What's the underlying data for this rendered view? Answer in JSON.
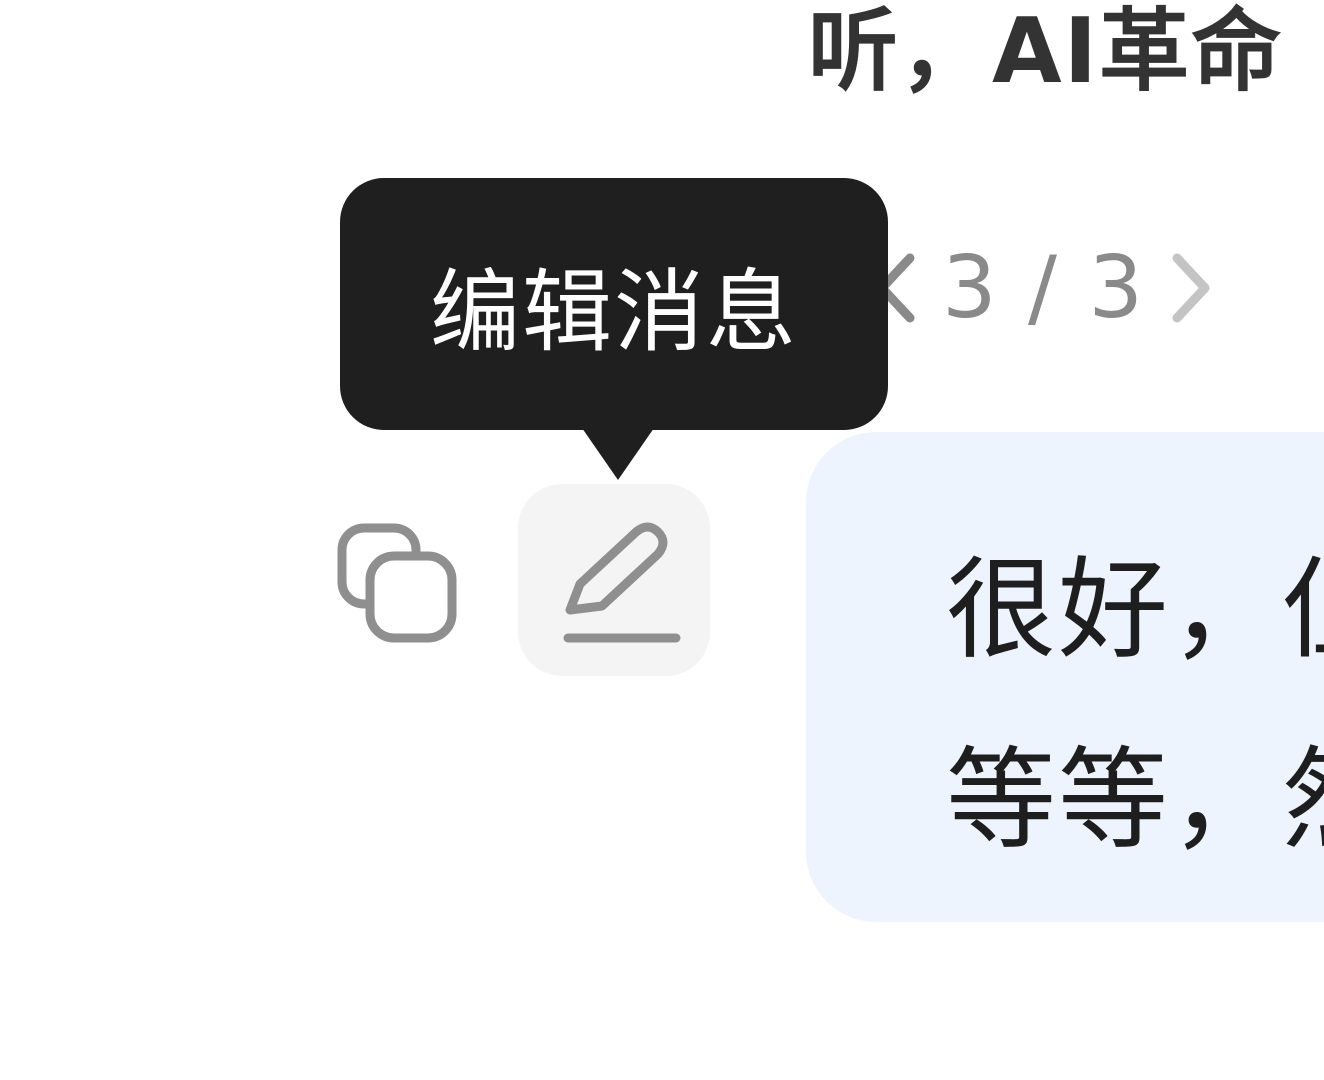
{
  "heading": {
    "text": "听，AI革命"
  },
  "pager": {
    "prev_icon": "chevron-left-icon",
    "next_icon": "chevron-right-icon",
    "count": "3 / 3"
  },
  "tooltip": {
    "text": "编辑消息"
  },
  "actions": {
    "copy_icon": "copy-icon",
    "edit_icon": "pencil-icon"
  },
  "message": {
    "lines": [
      "很好，但",
      "等等，然"
    ]
  },
  "colors": {
    "bubble_bg": "#edf4fe",
    "tooltip_bg": "#1f1f1f",
    "icon_gray": "#8a8a8a",
    "hover_bg": "#f4f4f4"
  }
}
